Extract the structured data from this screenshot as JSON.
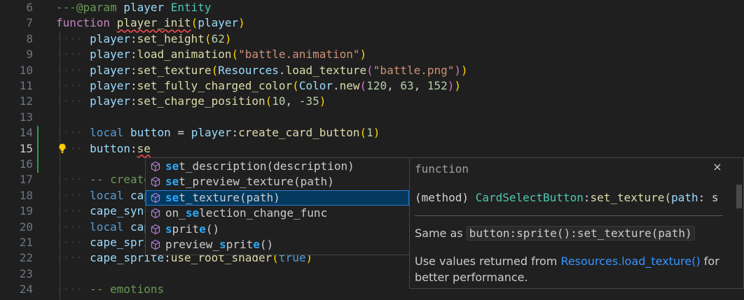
{
  "editor": {
    "lines": [
      {
        "n": "6",
        "parts": [
          [
            "c-comment",
            "---@param "
          ],
          [
            "c-var",
            "player"
          ],
          [
            "c-comment",
            " "
          ],
          [
            "c-cls",
            "Entity"
          ]
        ]
      },
      {
        "n": "7",
        "parts": [
          [
            "c-kw",
            "function"
          ],
          [
            "c-tx",
            " "
          ],
          [
            "c-fn squig",
            "player_init"
          ],
          [
            "br1",
            "("
          ],
          [
            "c-var",
            "player"
          ],
          [
            "br1",
            ")"
          ]
        ]
      },
      {
        "n": "8",
        "ind": 1,
        "parts": [
          [
            "c-var",
            "player"
          ],
          [
            "c-tx",
            ":"
          ],
          [
            "c-fn",
            "set_height"
          ],
          [
            "br1",
            "("
          ],
          [
            "c-num",
            "62"
          ],
          [
            "br1",
            ")"
          ]
        ]
      },
      {
        "n": "9",
        "ind": 1,
        "parts": [
          [
            "c-var",
            "player"
          ],
          [
            "c-tx",
            ":"
          ],
          [
            "c-fn",
            "load_animation"
          ],
          [
            "br1",
            "("
          ],
          [
            "c-str",
            "\"battle.animation\""
          ],
          [
            "br1",
            ")"
          ]
        ]
      },
      {
        "n": "10",
        "ind": 1,
        "parts": [
          [
            "c-var",
            "player"
          ],
          [
            "c-tx",
            ":"
          ],
          [
            "c-fn",
            "set_texture"
          ],
          [
            "br1",
            "("
          ],
          [
            "c-var",
            "Resources"
          ],
          [
            "c-tx",
            "."
          ],
          [
            "c-fn",
            "load_texture"
          ],
          [
            "br2",
            "("
          ],
          [
            "c-str",
            "\"battle.png\""
          ],
          [
            "br2",
            ")"
          ],
          [
            "br1",
            ")"
          ]
        ]
      },
      {
        "n": "11",
        "ind": 1,
        "parts": [
          [
            "c-var",
            "player"
          ],
          [
            "c-tx",
            ":"
          ],
          [
            "c-fn",
            "set_fully_charged_color"
          ],
          [
            "br1",
            "("
          ],
          [
            "c-var",
            "Color"
          ],
          [
            "c-tx",
            "."
          ],
          [
            "c-fn",
            "new"
          ],
          [
            "br2",
            "("
          ],
          [
            "c-num",
            "120"
          ],
          [
            "c-tx",
            ", "
          ],
          [
            "c-num",
            "63"
          ],
          [
            "c-tx",
            ", "
          ],
          [
            "c-num",
            "152"
          ],
          [
            "br2",
            ")"
          ],
          [
            "br1",
            ")"
          ]
        ]
      },
      {
        "n": "12",
        "ind": 1,
        "parts": [
          [
            "c-var",
            "player"
          ],
          [
            "c-tx",
            ":"
          ],
          [
            "c-fn",
            "set_charge_position"
          ],
          [
            "br1",
            "("
          ],
          [
            "c-num",
            "10"
          ],
          [
            "c-tx",
            ", "
          ],
          [
            "c-num",
            "-35"
          ],
          [
            "br1",
            ")"
          ]
        ]
      },
      {
        "n": "13",
        "parts": []
      },
      {
        "n": "14",
        "ind": 1,
        "parts": [
          [
            "c-kw2",
            "local"
          ],
          [
            "c-tx",
            " "
          ],
          [
            "c-var",
            "button"
          ],
          [
            "c-tx",
            " = "
          ],
          [
            "c-var",
            "player"
          ],
          [
            "c-tx",
            ":"
          ],
          [
            "c-fn",
            "create_card_button"
          ],
          [
            "br1",
            "("
          ],
          [
            "c-num",
            "1"
          ],
          [
            "br1",
            ")"
          ]
        ]
      },
      {
        "n": "15",
        "ind": 1,
        "cur": true,
        "parts": [
          [
            "c-var",
            "button"
          ],
          [
            "c-tx",
            ":"
          ],
          [
            "c-fn squig",
            "se"
          ]
        ]
      },
      {
        "n": "16",
        "parts": []
      },
      {
        "n": "17",
        "ind": 1,
        "parts": [
          [
            "c-comment",
            "-- create"
          ]
        ]
      },
      {
        "n": "18",
        "ind": 1,
        "parts": [
          [
            "c-kw2",
            "local"
          ],
          [
            "c-tx",
            " "
          ],
          [
            "c-var",
            "cap"
          ]
        ]
      },
      {
        "n": "19",
        "ind": 1,
        "parts": [
          [
            "c-var",
            "cape_sync"
          ]
        ]
      },
      {
        "n": "20",
        "ind": 1,
        "parts": [
          [
            "c-kw2",
            "local"
          ],
          [
            "c-tx",
            " "
          ],
          [
            "c-var",
            "cap"
          ]
        ]
      },
      {
        "n": "21",
        "ind": 1,
        "parts": [
          [
            "c-var",
            "cape_sprit"
          ]
        ]
      },
      {
        "n": "22",
        "ind": 1,
        "parts": [
          [
            "c-var",
            "cape_sprite"
          ],
          [
            "c-tx",
            ":"
          ],
          [
            "c-fn",
            "use_root_shader"
          ],
          [
            "br1",
            "("
          ],
          [
            "c-kw2",
            "true"
          ],
          [
            "br1",
            ")"
          ]
        ]
      },
      {
        "n": "23",
        "parts": []
      },
      {
        "n": "24",
        "ind": 1,
        "parts": [
          [
            "c-comment",
            "-- emotions"
          ]
        ]
      }
    ]
  },
  "suggest": {
    "selected_index": 2,
    "items": [
      {
        "pre": "",
        "match": "se",
        "post": "t_description(description)"
      },
      {
        "pre": "",
        "match": "se",
        "post": "t_preview_texture(path)"
      },
      {
        "pre": "",
        "match": "se",
        "post": "t_texture(path)"
      },
      {
        "pre": "on_",
        "match": "se",
        "post": "lection_change_func"
      },
      {
        "pre": "",
        "match": "s",
        "mid": "prit",
        "match2": "e",
        "post": "()"
      },
      {
        "pre": "preview_",
        "match": "s",
        "mid": "prit",
        "match2": "e",
        "post": "()"
      }
    ]
  },
  "details": {
    "kind": "function",
    "close_glyph": "×",
    "sig_open": "(method) ",
    "sig_class": "CardSelectButton",
    "sig_sep": ":",
    "sig_fn": "set_texture",
    "sig_paren": "(",
    "sig_param": "path",
    "sig_rest": ": s",
    "doc_same_prefix": "Same as ",
    "doc_same_code": "button:sprite():set_texture(path)",
    "doc_use_prefix": "Use values returned from ",
    "doc_use_link": "Resources.load_texture()",
    "doc_use_suffix": " for",
    "doc_use_line2": "better performance."
  },
  "icons": {
    "suggest_item": "method-cube-icon",
    "lightbulb": "lightbulb-icon",
    "close": "close-icon"
  },
  "colors": {
    "background": "#1f1f1f",
    "selection": "#04395e",
    "match_highlight": "#2aaaff",
    "gutter_added": "#2ea043"
  }
}
